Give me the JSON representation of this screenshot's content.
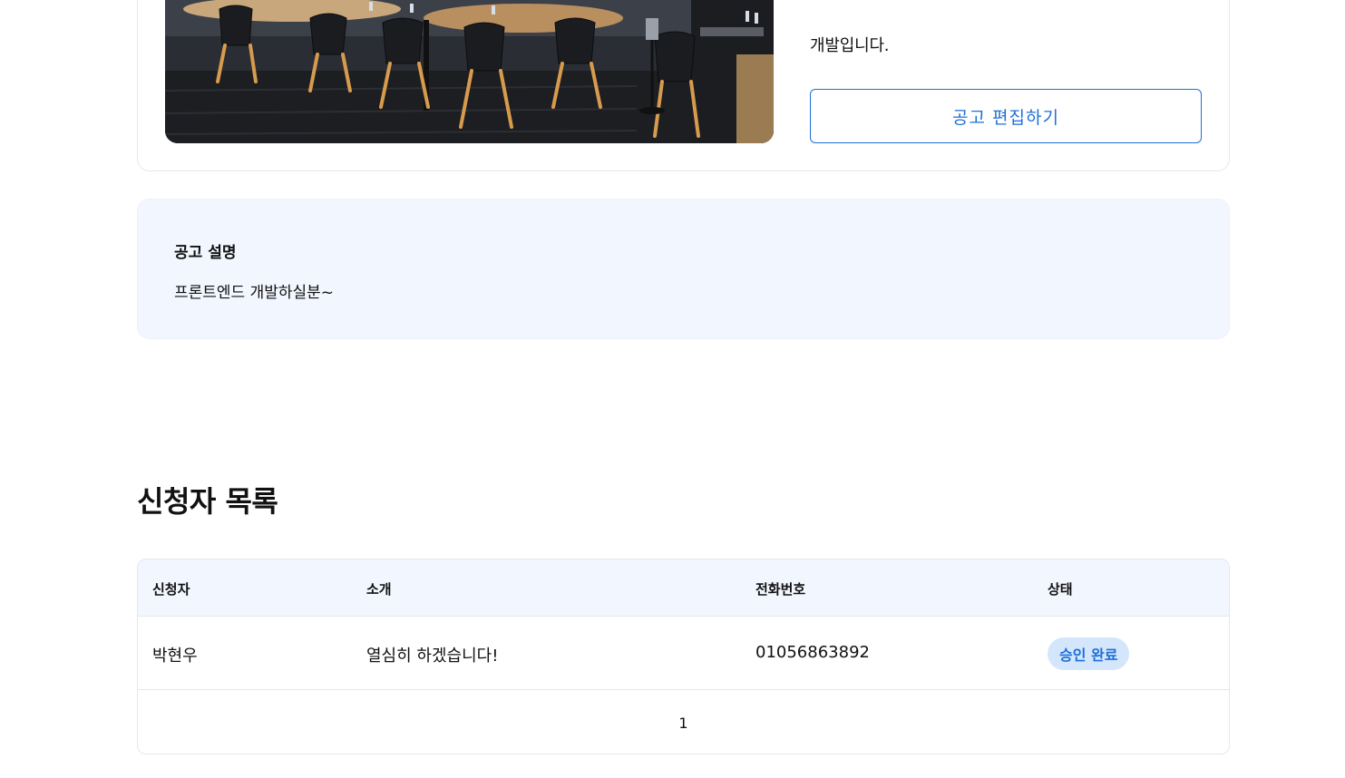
{
  "notice": {
    "description_tail": "개발입니다.",
    "edit_button_label": "공고 편집하기",
    "image_alt": "restaurant-interior"
  },
  "description": {
    "title": "공고 설명",
    "body": "프론트엔드 개발하실분~"
  },
  "applicants": {
    "title": "신청자 목록",
    "columns": [
      "신청자",
      "소개",
      "전화번호",
      "상태"
    ],
    "rows": [
      {
        "name": "박현우",
        "intro": "열심히 하겠습니다!",
        "phone": "01056863892",
        "status": "승인 완료"
      }
    ],
    "pagination": {
      "pages": [
        "1"
      ],
      "current": "1"
    }
  },
  "colors": {
    "accent": "#1e6fd9",
    "badge_bg": "#d4e6fb",
    "panel_bg": "#f2f6fe",
    "border": "#e5e7eb"
  }
}
